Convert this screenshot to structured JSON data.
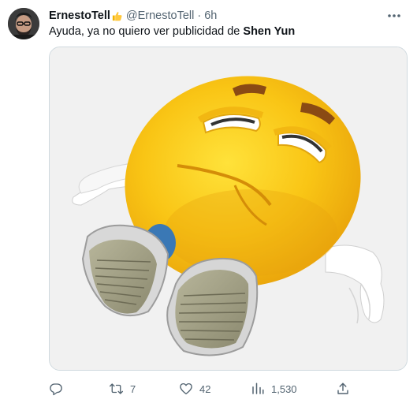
{
  "author": {
    "display_name": "ErnestoTell",
    "name_emoji": "thumbs-up-emoji",
    "handle": "@ErnestoTell",
    "separator": "·",
    "time": "6h"
  },
  "tweet": {
    "text_prefix": "Ayuda, ya no quiero ver publicidad de ",
    "text_bold": "Shen Yun"
  },
  "media": {
    "subject": "exhausted-emoji-character-image"
  },
  "actions": {
    "reply": {
      "icon": "reply-icon",
      "count": ""
    },
    "retweet": {
      "icon": "retweet-icon",
      "count": "7"
    },
    "like": {
      "icon": "heart-icon",
      "count": "42"
    },
    "views": {
      "icon": "views-icon",
      "count": "1,530"
    },
    "share": {
      "icon": "share-icon",
      "count": ""
    }
  },
  "colors": {
    "text": "#0f1419",
    "secondary": "#536471",
    "border": "#cfd9de",
    "emoji_yellow": "#f7c21a"
  }
}
